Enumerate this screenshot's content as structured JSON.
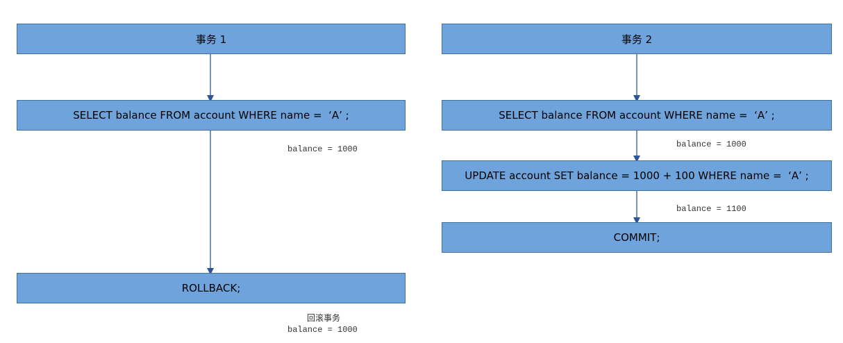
{
  "transaction1": {
    "title": "事务 1",
    "select": "SELECT balance FROM account WHERE name =  ‘A’ ;",
    "select_result": "balance = 1000",
    "rollback": "ROLLBACK;",
    "rollback_note": "回滚事务",
    "rollback_result": "balance = 1000"
  },
  "transaction2": {
    "title": "事务 2",
    "select": "SELECT balance FROM account WHERE name =  ‘A’ ;",
    "select_result": "balance = 1000",
    "update": "UPDATE account SET balance = 1000 + 100 WHERE name =  ‘A’ ;",
    "update_result": "balance = 1100",
    "commit": "COMMIT;"
  },
  "colors": {
    "box_fill": "#6fa3dc",
    "box_border": "#41719c",
    "arrow": "#2f5597"
  }
}
